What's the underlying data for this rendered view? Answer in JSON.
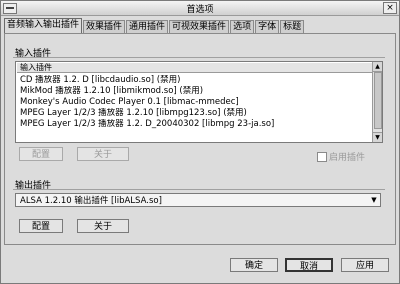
{
  "window": {
    "title": "首选项"
  },
  "tabs": [
    {
      "label": "音频输入输出插件"
    },
    {
      "label": "效果插件"
    },
    {
      "label": "通用插件"
    },
    {
      "label": "可视效果插件"
    },
    {
      "label": "选项"
    },
    {
      "label": "字体"
    },
    {
      "label": "标题"
    }
  ],
  "input_plugins": {
    "section_label": "输入插件",
    "list_header": "输入插件",
    "items": [
      "CD 播放器 1.2. D  [libcdaudio.so]  (禁用)",
      "MikMod 播放器 1.2.10  [libmikmod.so]  (禁用)",
      "Monkey's Audio Codec Player 0.1  [libmac-mmedec]",
      "MPEG Layer 1/2/3 播放器 1.2.10  [libmpg123.so]  (禁用)",
      "MPEG Layer 1/2/3 播放器 1.2. D_20040302  [libmpg 23-ja.so]"
    ],
    "config_label": "配置",
    "about_label": "关于",
    "enable_label": "启用插件"
  },
  "output_plugins": {
    "section_label": "输出插件",
    "selected": "ALSA 1.2.10 输出插件  [libALSA.so]",
    "config_label": "配置",
    "about_label": "关于"
  },
  "footer": {
    "ok_label": "确定",
    "cancel_label": "取消",
    "apply_label": "应用"
  }
}
